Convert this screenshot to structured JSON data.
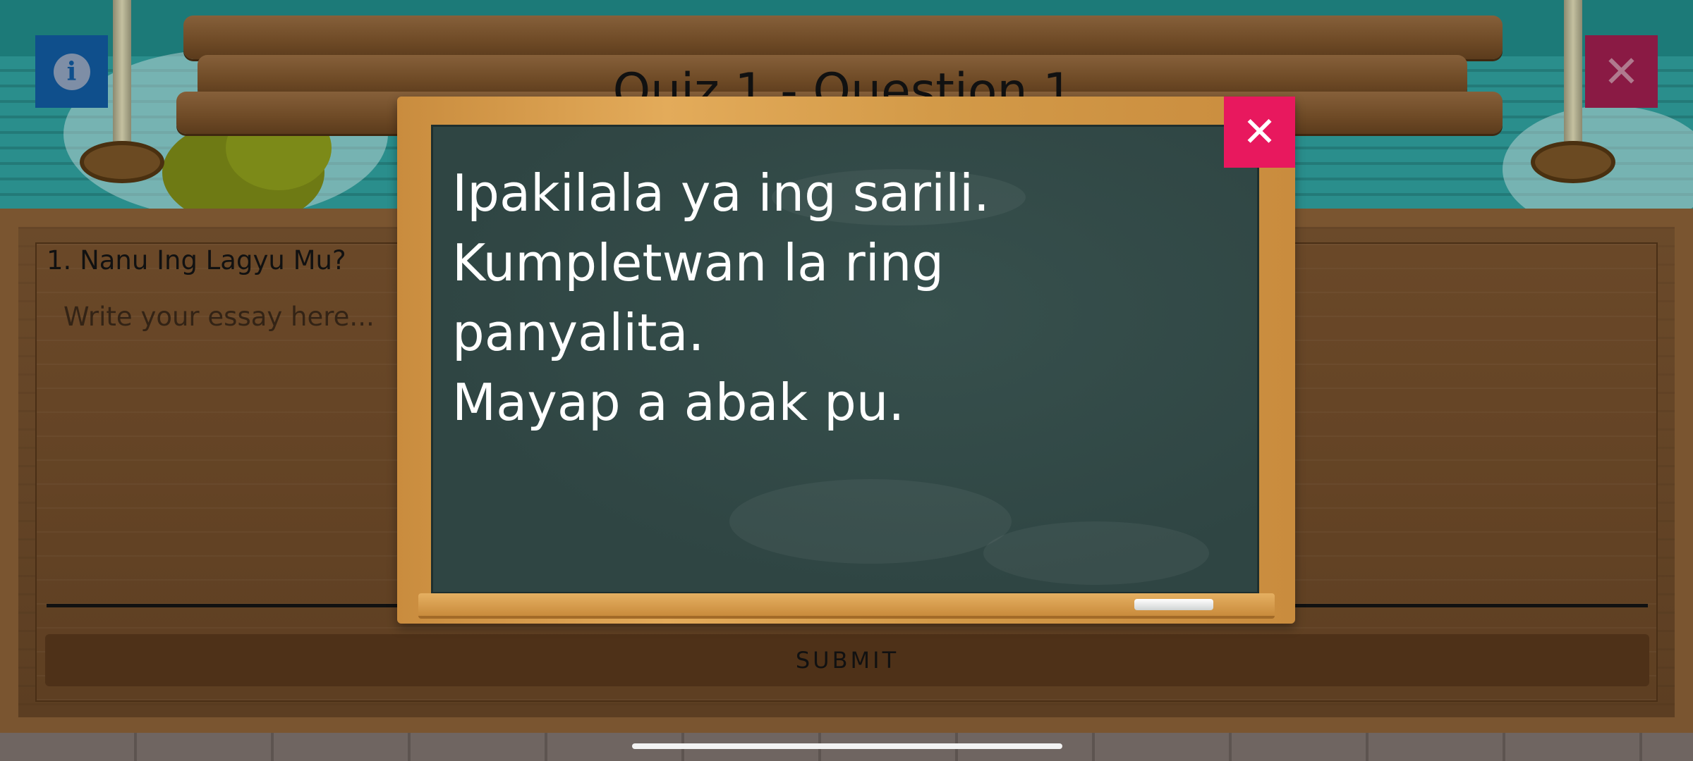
{
  "header": {
    "title": "Quiz 1 - Question 1",
    "info_icon": "info-icon",
    "info_glyph": "i",
    "exit_icon": "close-icon",
    "exit_glyph": "✕"
  },
  "question": {
    "label": "1. Nanu Ing Lagyu Mu?",
    "placeholder": "Write your essay here...",
    "value": ""
  },
  "submit": {
    "label": "SUBMIT"
  },
  "modal": {
    "instructions": "Ipakilala ya ing sarili.\nKumpletwan la ring\npanyalita.\nMayap a abak pu.",
    "close_icon": "close-icon",
    "close_glyph": "✕"
  },
  "colors": {
    "info_button": "#0f4f8c",
    "exit_button": "#8a1a44",
    "modal_close": "#e8185e",
    "chalkboard": "#2f4543",
    "wood": "#6a4828"
  }
}
